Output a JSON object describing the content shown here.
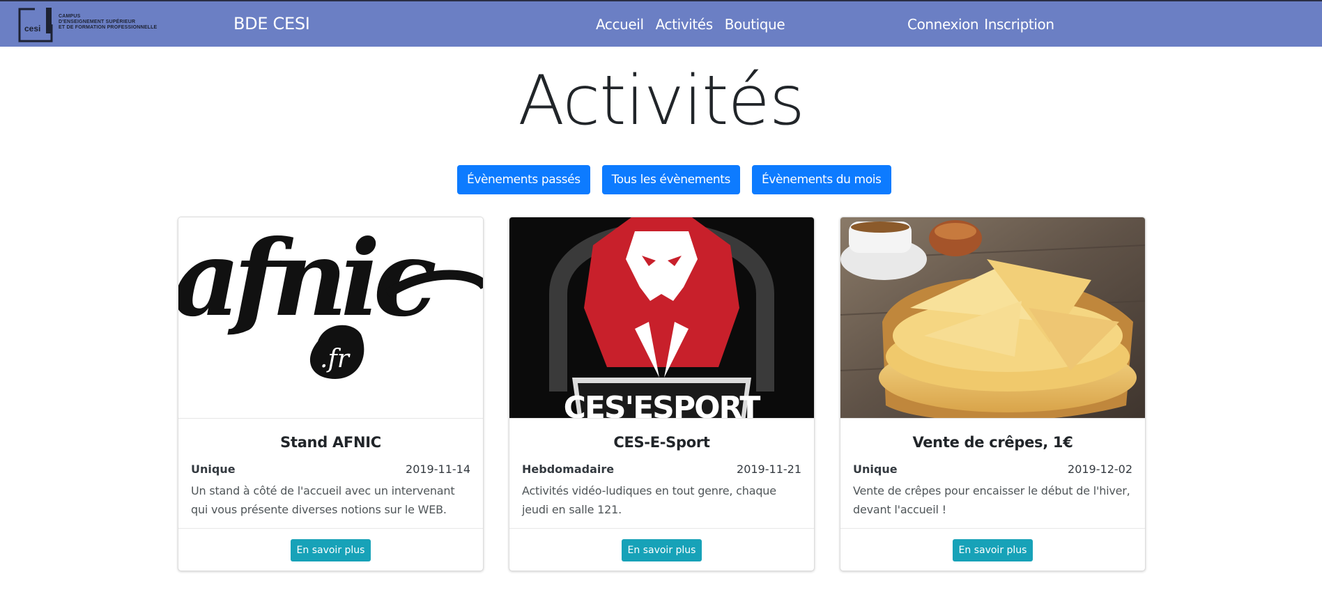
{
  "header": {
    "logo_lines": [
      "CAMPUS",
      "D'ENSEIGNEMENT SUPÉRIEUR",
      "ET DE FORMATION PROFESSIONNELLE"
    ],
    "logo_mark_text": "cesi",
    "brand": "BDE CESI",
    "nav": [
      "Accueil",
      "Activités",
      "Boutique"
    ],
    "auth": [
      "Connexion",
      "Inscription"
    ]
  },
  "page": {
    "title": "Activités",
    "filters": [
      "Évènements passés",
      "Tous les évènements",
      "Évènements du mois"
    ]
  },
  "cards": [
    {
      "image": "afnic-logo",
      "image_text": "afnic",
      "image_badge_text": ".fr",
      "title": "Stand AFNIC",
      "frequency": "Unique",
      "date": "2019-11-14",
      "description": "Un stand à côté de l'accueil avec un intervenant qui vous présente diverses notions sur le WEB.",
      "button": "En savoir plus"
    },
    {
      "image": "ces-esport-lion-logo",
      "image_text": "CES'ESPORT",
      "title": "CES-E-Sport",
      "frequency": "Hebdomadaire",
      "date": "2019-11-21",
      "description": "Activités vidéo-ludiques en tout genre, chaque jeudi en salle 121.",
      "button": "En savoir plus"
    },
    {
      "image": "crepes-photo",
      "title": "Vente de crêpes, 1€",
      "frequency": "Unique",
      "date": "2019-12-02",
      "description": "Vente de crêpes pour encaisser le début de l'hiver, devant l'accueil !",
      "button": "En savoir plus"
    }
  ],
  "colors": {
    "navbar": "#6b7fc4",
    "primary": "#0d7bff",
    "info": "#17a2b8"
  }
}
